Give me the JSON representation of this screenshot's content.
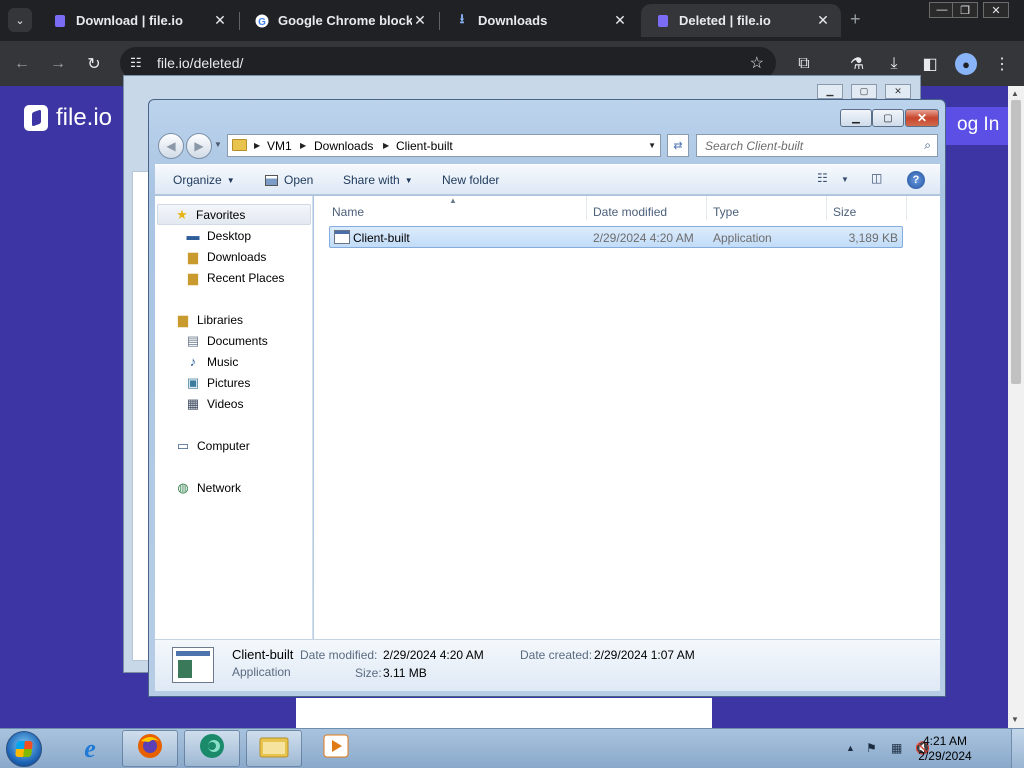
{
  "browser": {
    "tabs": [
      {
        "label": "Download | file.io",
        "active": false
      },
      {
        "label": "Google Chrome blocks",
        "active": false
      },
      {
        "label": "Downloads",
        "active": false
      },
      {
        "label": "Deleted | file.io",
        "active": true
      }
    ],
    "new_tab_glyph": "+",
    "url": "file.io/deleted/",
    "window_controls": {
      "minimize": "—",
      "restore": "❐",
      "close": "✕"
    }
  },
  "page": {
    "logo_text": "file.io",
    "login_label": "og In"
  },
  "explorer": {
    "breadcrumb": [
      "VM1",
      "Downloads",
      "Client-built"
    ],
    "search_placeholder": "Search Client-built",
    "commands": {
      "organize": "Organize",
      "open": "Open",
      "share_with": "Share with",
      "new_folder": "New folder"
    },
    "nav": {
      "favorites": "Favorites",
      "favorites_items": [
        "Desktop",
        "Downloads",
        "Recent Places"
      ],
      "libraries": "Libraries",
      "libraries_items": [
        "Documents",
        "Music",
        "Pictures",
        "Videos"
      ],
      "computer": "Computer",
      "network": "Network"
    },
    "columns": {
      "name": "Name",
      "date_modified": "Date modified",
      "type": "Type",
      "size": "Size"
    },
    "files": [
      {
        "name": "Client-built",
        "date_modified": "2/29/2024 4:20 AM",
        "type": "Application",
        "size": "3,189 KB"
      }
    ],
    "details": {
      "name": "Client-built",
      "type": "Application",
      "date_modified_label": "Date modified:",
      "date_modified": "2/29/2024 4:20 AM",
      "date_created_label": "Date created:",
      "date_created": "2/29/2024 1:07 AM",
      "size_label": "Size:",
      "size": "3.11 MB"
    }
  },
  "taskbar": {
    "time": "4:21 AM",
    "date": "2/29/2024"
  },
  "colors": {
    "page_bg": "#3d35a4",
    "login_bg": "#5b4fe6",
    "chrome_dark": "#202124",
    "chrome_toolbar": "#35363a",
    "selection": "#c2dcf8"
  }
}
